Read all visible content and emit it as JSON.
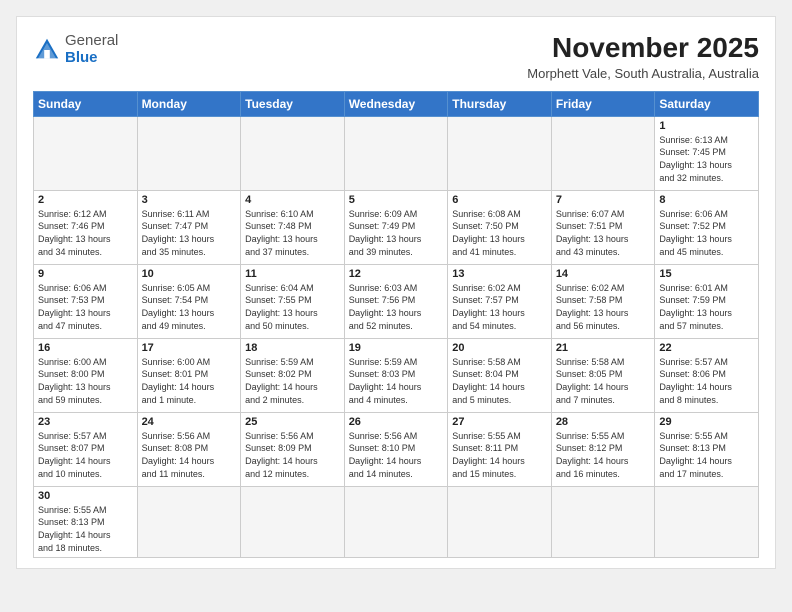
{
  "header": {
    "logo_general": "General",
    "logo_blue": "Blue",
    "month": "November 2025",
    "location": "Morphett Vale, South Australia, Australia"
  },
  "weekdays": [
    "Sunday",
    "Monday",
    "Tuesday",
    "Wednesday",
    "Thursday",
    "Friday",
    "Saturday"
  ],
  "weeks": [
    [
      {
        "day": "",
        "info": ""
      },
      {
        "day": "",
        "info": ""
      },
      {
        "day": "",
        "info": ""
      },
      {
        "day": "",
        "info": ""
      },
      {
        "day": "",
        "info": ""
      },
      {
        "day": "",
        "info": ""
      },
      {
        "day": "1",
        "info": "Sunrise: 6:13 AM\nSunset: 7:45 PM\nDaylight: 13 hours\nand 32 minutes."
      }
    ],
    [
      {
        "day": "2",
        "info": "Sunrise: 6:12 AM\nSunset: 7:46 PM\nDaylight: 13 hours\nand 34 minutes."
      },
      {
        "day": "3",
        "info": "Sunrise: 6:11 AM\nSunset: 7:47 PM\nDaylight: 13 hours\nand 35 minutes."
      },
      {
        "day": "4",
        "info": "Sunrise: 6:10 AM\nSunset: 7:48 PM\nDaylight: 13 hours\nand 37 minutes."
      },
      {
        "day": "5",
        "info": "Sunrise: 6:09 AM\nSunset: 7:49 PM\nDaylight: 13 hours\nand 39 minutes."
      },
      {
        "day": "6",
        "info": "Sunrise: 6:08 AM\nSunset: 7:50 PM\nDaylight: 13 hours\nand 41 minutes."
      },
      {
        "day": "7",
        "info": "Sunrise: 6:07 AM\nSunset: 7:51 PM\nDaylight: 13 hours\nand 43 minutes."
      },
      {
        "day": "8",
        "info": "Sunrise: 6:06 AM\nSunset: 7:52 PM\nDaylight: 13 hours\nand 45 minutes."
      }
    ],
    [
      {
        "day": "9",
        "info": "Sunrise: 6:06 AM\nSunset: 7:53 PM\nDaylight: 13 hours\nand 47 minutes."
      },
      {
        "day": "10",
        "info": "Sunrise: 6:05 AM\nSunset: 7:54 PM\nDaylight: 13 hours\nand 49 minutes."
      },
      {
        "day": "11",
        "info": "Sunrise: 6:04 AM\nSunset: 7:55 PM\nDaylight: 13 hours\nand 50 minutes."
      },
      {
        "day": "12",
        "info": "Sunrise: 6:03 AM\nSunset: 7:56 PM\nDaylight: 13 hours\nand 52 minutes."
      },
      {
        "day": "13",
        "info": "Sunrise: 6:02 AM\nSunset: 7:57 PM\nDaylight: 13 hours\nand 54 minutes."
      },
      {
        "day": "14",
        "info": "Sunrise: 6:02 AM\nSunset: 7:58 PM\nDaylight: 13 hours\nand 56 minutes."
      },
      {
        "day": "15",
        "info": "Sunrise: 6:01 AM\nSunset: 7:59 PM\nDaylight: 13 hours\nand 57 minutes."
      }
    ],
    [
      {
        "day": "16",
        "info": "Sunrise: 6:00 AM\nSunset: 8:00 PM\nDaylight: 13 hours\nand 59 minutes."
      },
      {
        "day": "17",
        "info": "Sunrise: 6:00 AM\nSunset: 8:01 PM\nDaylight: 14 hours\nand 1 minute."
      },
      {
        "day": "18",
        "info": "Sunrise: 5:59 AM\nSunset: 8:02 PM\nDaylight: 14 hours\nand 2 minutes."
      },
      {
        "day": "19",
        "info": "Sunrise: 5:59 AM\nSunset: 8:03 PM\nDaylight: 14 hours\nand 4 minutes."
      },
      {
        "day": "20",
        "info": "Sunrise: 5:58 AM\nSunset: 8:04 PM\nDaylight: 14 hours\nand 5 minutes."
      },
      {
        "day": "21",
        "info": "Sunrise: 5:58 AM\nSunset: 8:05 PM\nDaylight: 14 hours\nand 7 minutes."
      },
      {
        "day": "22",
        "info": "Sunrise: 5:57 AM\nSunset: 8:06 PM\nDaylight: 14 hours\nand 8 minutes."
      }
    ],
    [
      {
        "day": "23",
        "info": "Sunrise: 5:57 AM\nSunset: 8:07 PM\nDaylight: 14 hours\nand 10 minutes."
      },
      {
        "day": "24",
        "info": "Sunrise: 5:56 AM\nSunset: 8:08 PM\nDaylight: 14 hours\nand 11 minutes."
      },
      {
        "day": "25",
        "info": "Sunrise: 5:56 AM\nSunset: 8:09 PM\nDaylight: 14 hours\nand 12 minutes."
      },
      {
        "day": "26",
        "info": "Sunrise: 5:56 AM\nSunset: 8:10 PM\nDaylight: 14 hours\nand 14 minutes."
      },
      {
        "day": "27",
        "info": "Sunrise: 5:55 AM\nSunset: 8:11 PM\nDaylight: 14 hours\nand 15 minutes."
      },
      {
        "day": "28",
        "info": "Sunrise: 5:55 AM\nSunset: 8:12 PM\nDaylight: 14 hours\nand 16 minutes."
      },
      {
        "day": "29",
        "info": "Sunrise: 5:55 AM\nSunset: 8:13 PM\nDaylight: 14 hours\nand 17 minutes."
      }
    ],
    [
      {
        "day": "30",
        "info": "Sunrise: 5:55 AM\nSunset: 8:13 PM\nDaylight: 14 hours\nand 18 minutes."
      },
      {
        "day": "",
        "info": ""
      },
      {
        "day": "",
        "info": ""
      },
      {
        "day": "",
        "info": ""
      },
      {
        "day": "",
        "info": ""
      },
      {
        "day": "",
        "info": ""
      },
      {
        "day": "",
        "info": ""
      }
    ]
  ]
}
